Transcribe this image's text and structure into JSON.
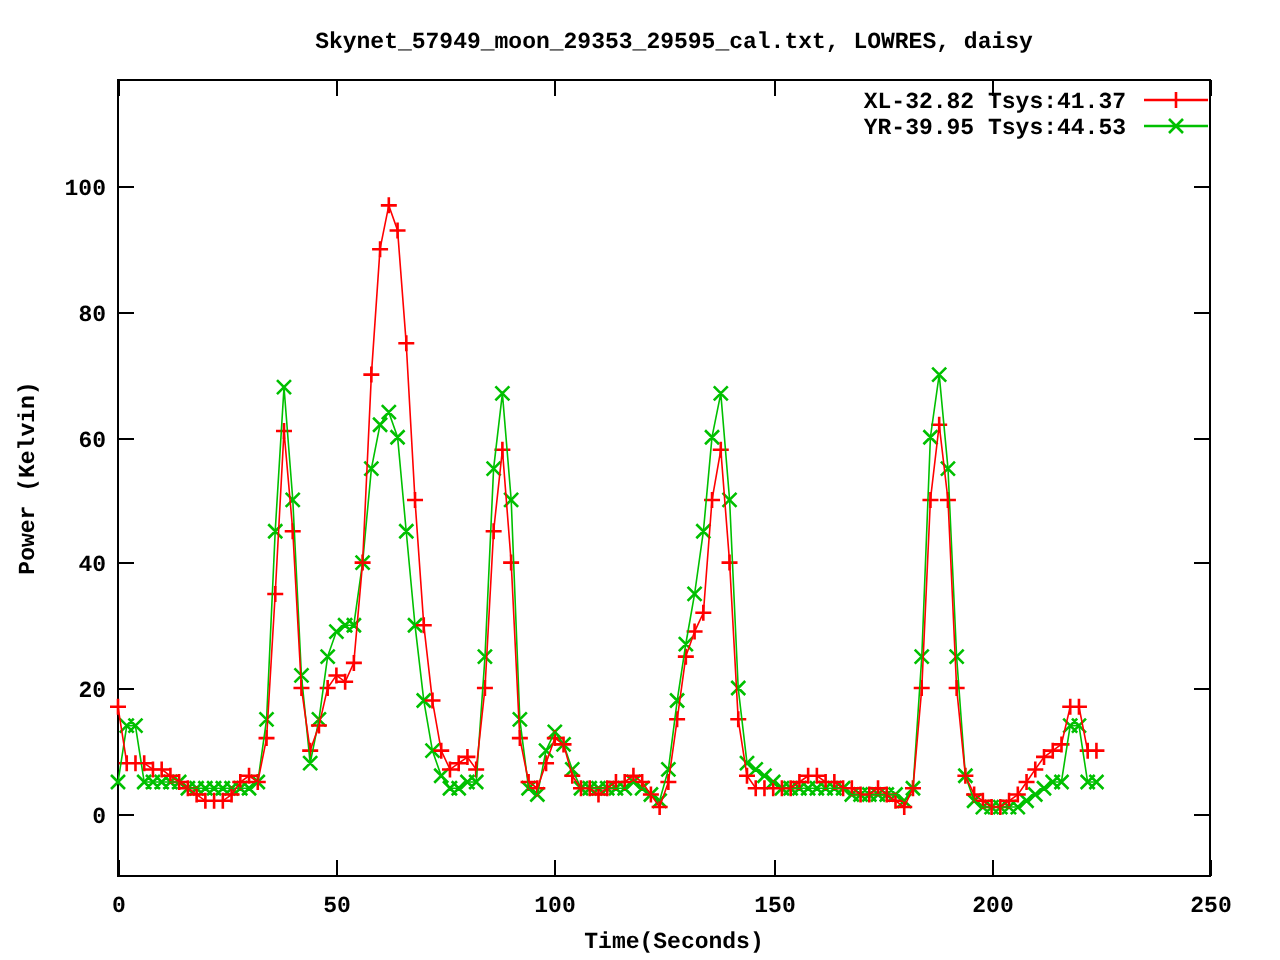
{
  "chart_data": {
    "type": "line",
    "title": "Skynet_57949_moon_29353_29595_cal.txt, LOWRES, daisy",
    "xlabel": "Time(Seconds)",
    "ylabel": "Power (Kelvin)",
    "x": [
      0,
      2,
      4,
      6,
      8,
      10,
      12,
      14,
      16,
      18,
      20,
      22,
      24,
      26,
      28,
      30,
      32,
      34,
      36,
      38,
      40,
      42,
      44,
      46,
      48,
      50,
      52,
      54,
      56,
      58,
      60,
      62,
      64,
      66,
      68,
      70,
      72,
      74,
      76,
      78,
      80,
      82,
      84,
      86,
      88,
      90,
      92,
      94,
      96,
      98,
      100,
      102,
      104,
      106,
      108,
      110,
      112,
      114,
      116,
      118,
      120,
      122,
      124,
      126,
      128,
      130,
      132,
      134,
      136,
      138,
      140,
      142,
      144,
      146,
      148,
      150,
      152,
      154,
      156,
      158,
      160,
      162,
      164,
      166,
      168,
      170,
      172,
      174,
      176,
      178,
      180,
      182,
      184,
      186,
      188,
      190,
      192,
      194,
      196,
      198,
      200,
      202,
      204,
      206,
      208,
      210,
      212,
      214,
      216,
      218,
      220,
      222,
      224
    ],
    "series": [
      {
        "name": "XL-32.82 Tsys:41.37",
        "color": "#ff0000",
        "marker": "plus",
        "values": [
          17,
          8,
          8,
          8,
          7,
          7,
          6,
          5,
          4,
          3,
          2,
          2,
          2,
          3,
          5,
          6,
          5,
          12,
          35,
          61,
          45,
          20,
          10,
          14,
          20,
          22,
          21,
          24,
          40,
          70,
          90,
          97,
          93,
          75,
          50,
          30,
          18,
          10,
          7,
          8,
          9,
          7,
          20,
          45,
          58,
          40,
          12,
          5,
          4,
          8,
          12,
          11,
          6,
          4,
          4,
          3,
          4,
          5,
          5,
          6,
          5,
          3,
          1,
          5,
          15,
          25,
          29,
          32,
          50,
          58,
          40,
          15,
          6,
          4,
          4,
          4,
          4,
          4,
          5,
          6,
          6,
          5,
          5,
          4,
          4,
          3,
          3,
          4,
          3,
          2,
          1,
          4,
          20,
          50,
          62,
          50,
          20,
          6,
          3,
          2,
          1,
          1,
          2,
          3,
          5,
          7,
          9,
          10,
          11,
          17,
          17,
          10,
          10
        ]
      },
      {
        "name": "YR-39.95 Tsys:44.53",
        "color": "#00c000",
        "marker": "cross",
        "values": [
          5,
          14,
          14,
          5,
          5,
          5,
          5,
          5,
          4,
          4,
          4,
          4,
          4,
          4,
          4,
          4,
          5,
          15,
          45,
          68,
          50,
          22,
          8,
          15,
          25,
          29,
          30,
          30,
          40,
          55,
          62,
          64,
          60,
          45,
          30,
          18,
          10,
          6,
          4,
          4,
          5,
          5,
          25,
          55,
          67,
          50,
          15,
          4,
          3,
          10,
          13,
          11,
          7,
          4,
          4,
          4,
          4,
          4,
          4,
          5,
          4,
          3,
          2,
          7,
          18,
          27,
          35,
          45,
          60,
          67,
          50,
          20,
          8,
          7,
          6,
          5,
          4,
          4,
          4,
          4,
          4,
          4,
          4,
          4,
          3,
          3,
          3,
          3,
          3,
          3,
          2,
          4,
          25,
          60,
          70,
          55,
          25,
          6,
          2,
          1,
          1,
          1,
          1,
          1,
          2,
          3,
          4,
          5,
          5,
          14,
          14,
          5,
          5
        ]
      }
    ],
    "legend": true,
    "xlim": [
      0,
      250
    ],
    "ylim": [
      -10,
      117
    ],
    "xticks": [
      0,
      50,
      100,
      150,
      200,
      250
    ],
    "yticks": [
      0,
      20,
      40,
      60,
      80,
      100
    ]
  }
}
